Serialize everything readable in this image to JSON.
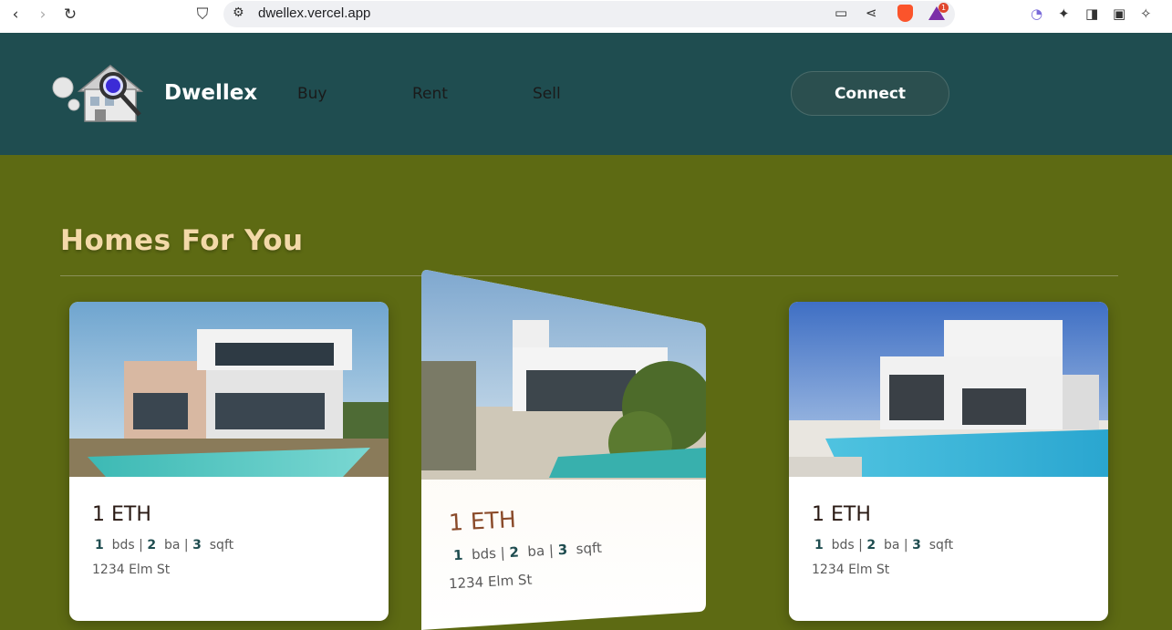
{
  "browser": {
    "url": "dwellex.vercel.app",
    "extension_badge": "1"
  },
  "site": {
    "brand": "Dwellex",
    "nav": [
      "Buy",
      "Rent",
      "Sell"
    ],
    "connect_label": "Connect"
  },
  "section": {
    "title": "Homes For You"
  },
  "listings": [
    {
      "price": "1 ETH",
      "beds": "1",
      "beds_label": "bds",
      "baths": "2",
      "baths_label": "ba",
      "sqft": "3",
      "sqft_label": "sqft",
      "address": "1234 Elm St"
    },
    {
      "price": "1 ETH",
      "beds": "1",
      "beds_label": "bds",
      "baths": "2",
      "baths_label": "ba",
      "sqft": "3",
      "sqft_label": "sqft",
      "address": "1234 Elm St"
    },
    {
      "price": "1 ETH",
      "beds": "1",
      "beds_label": "bds",
      "baths": "2",
      "baths_label": "ba",
      "sqft": "3",
      "sqft_label": "sqft",
      "address": "1234 Elm St"
    }
  ],
  "colors": {
    "page_bg": "#5d6a13",
    "header_bg": "#1f4d50",
    "title": "#f3d9a8",
    "accent": "#1f4d50"
  }
}
